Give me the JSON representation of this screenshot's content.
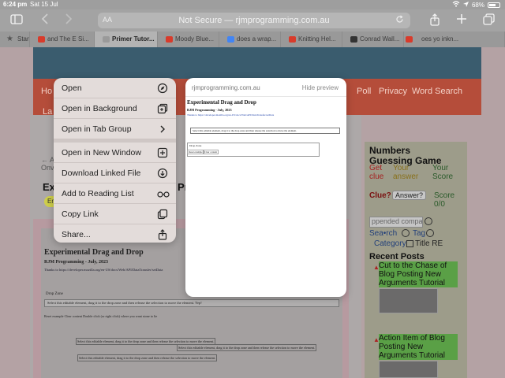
{
  "status_bar": {
    "time": "6:24 pm",
    "date": "Sat 15 Jul",
    "battery": "68%",
    "battery_level": 0.68
  },
  "toolbar": {
    "address_aa": "AA",
    "address_text": "Not Secure — rjmprogramming.com.au"
  },
  "tabs": [
    {
      "label": "Start",
      "color": "#555555"
    },
    {
      "label": "and The E Si...",
      "color": "#d83b2b"
    },
    {
      "label": "Primer Tutor...",
      "color": "#b3b3b3",
      "active": true
    },
    {
      "label": "Moody Blue...",
      "color": "#d83b2b"
    },
    {
      "label": "does a wrap...",
      "color": "#4285f4"
    },
    {
      "label": "Knitting Hel...",
      "color": "#d83b2b"
    },
    {
      "label": "Conrad Wall...",
      "color": "#333333"
    },
    {
      "label": "oes yo inkn...",
      "color": "#d83b2b"
    }
  ],
  "background_page": {
    "nav_links": [
      "Ho",
      "Poll",
      "Privacy",
      "Word Search",
      "La"
    ],
    "text_fragments": [
      "← A",
      "Onv",
      "Ex",
      "Pr",
      "En"
    ],
    "shot": {
      "title": "Experimental Drag and Drop",
      "byline": "RJM Programming - July, 2023",
      "thanks": "Thanks to https://developer.mozilla.org/en-US/docs/Web/API/DataTransfer/setData",
      "drop_zone": "Drop Zone",
      "instruction": "Select this editable element, drag it to the drop zone and then release the selection to move the element. Yep!",
      "buttons": "Reset example    Clear content    Double click (or right click) where you want stone to lie",
      "item": "Select this editable element, drag it to the drop zone and then release the selection to move the element."
    },
    "sidebar": {
      "game_title": "Numbers Guessing Game",
      "get_clue": "Get clue",
      "your_answer": "Your answer",
      "your_score": "Your Score",
      "clue": "Clue?",
      "answer_select": "Answer?",
      "score": "Score 0/0",
      "search_placeholder": "ppended compa",
      "search_text": "Sea•rch",
      "tag_text": "Tag",
      "category_text": "Category",
      "title_re": "Title RE",
      "recent_posts": "Recent Posts",
      "post1": "Cut to the Chase of Blog Posting New Arguments Tutorial",
      "post2": "Action Item of Blog Posting New Arguments Tutorial"
    }
  },
  "context_menu": {
    "items": [
      {
        "label": "Open",
        "icon": "compass-icon"
      },
      {
        "label": "Open in Background",
        "icon": "add-tab-icon"
      },
      {
        "label": "Open in Tab Group",
        "icon": "tab-group-icon"
      },
      {
        "label": "Open in New Window",
        "icon": "new-window-icon"
      },
      {
        "label": "Download Linked File",
        "icon": "download-icon"
      },
      {
        "label": "Add to Reading List",
        "icon": "glasses-icon"
      },
      {
        "label": "Copy Link",
        "icon": "copy-icon"
      },
      {
        "label": "Share...",
        "icon": "share-icon"
      }
    ]
  },
  "preview": {
    "domain": "rjmprogramming.com.au",
    "hide_label": "Hide preview",
    "title": "Experimental Drag and Drop",
    "byline": "RJM Programming - July, 2023",
    "thanks": "Thanks to https://developer.mozilla.org/en-US/docs/Web/API/DataTransfer/setData",
    "instruction": "Select this editable element, drag it to the drop zone and then release the selection to move the element.",
    "drop_zone": "Drop Zone",
    "buttons": [
      "Reset example",
      "Clear content"
    ]
  }
}
